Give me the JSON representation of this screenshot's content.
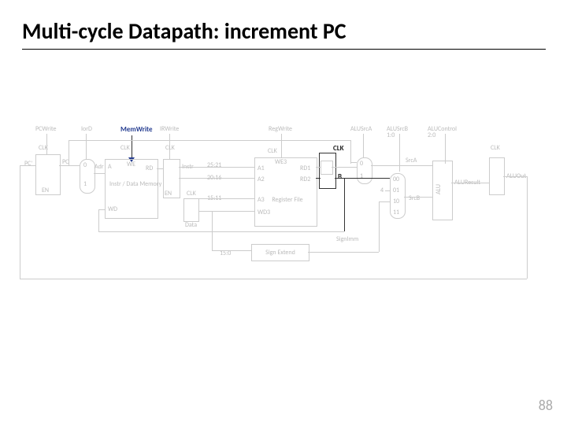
{
  "slide": {
    "title": "Multi-cycle Datapath: increment PC",
    "page_number": "88"
  },
  "controls": {
    "pcwrite": "PCWrite",
    "iord": "IorD",
    "memwrite": "MemWrite",
    "irwrite": "IRWrite",
    "regwrite": "RegWrite",
    "alusrca": "ALUSrcA",
    "alusrcb": "ALUSrcB",
    "alucontrol": "ALUControl",
    "clk": "CLK",
    "en": "EN",
    "we": "WE"
  },
  "blocks": {
    "pc": "PC",
    "pcprime": "PC'",
    "adr": "Adr",
    "a": "A",
    "rd_mem": "RD",
    "instr_data_mem": "Instr / Data\nMemory",
    "wd": "WD",
    "instr": "Instr",
    "data": "Data",
    "regfile": "Register\nFile",
    "a1": "A1",
    "a2": "A2",
    "a3": "A3",
    "wd3": "WD3",
    "rd1": "RD1",
    "rd2": "RD2",
    "we3": "WE3",
    "b": "B",
    "sign_extend": "Sign Extend",
    "signimm": "SignImm",
    "alu": "ALU",
    "aluresult": "ALUResult",
    "aluout": "ALUOut",
    "srca": "SrcA",
    "srcb": "SrcB"
  },
  "bits": {
    "rs": "25:21",
    "rt": "20:16",
    "rd": "15:11",
    "imm": "15:0"
  },
  "mux": {
    "srcb_00": "00",
    "srcb_01": "01",
    "srcb_10": "10",
    "srcb_11": "11",
    "four": "4",
    "zero": "0",
    "one": "1",
    "sub1_0": "1:0",
    "sub2_0": "2:0"
  }
}
